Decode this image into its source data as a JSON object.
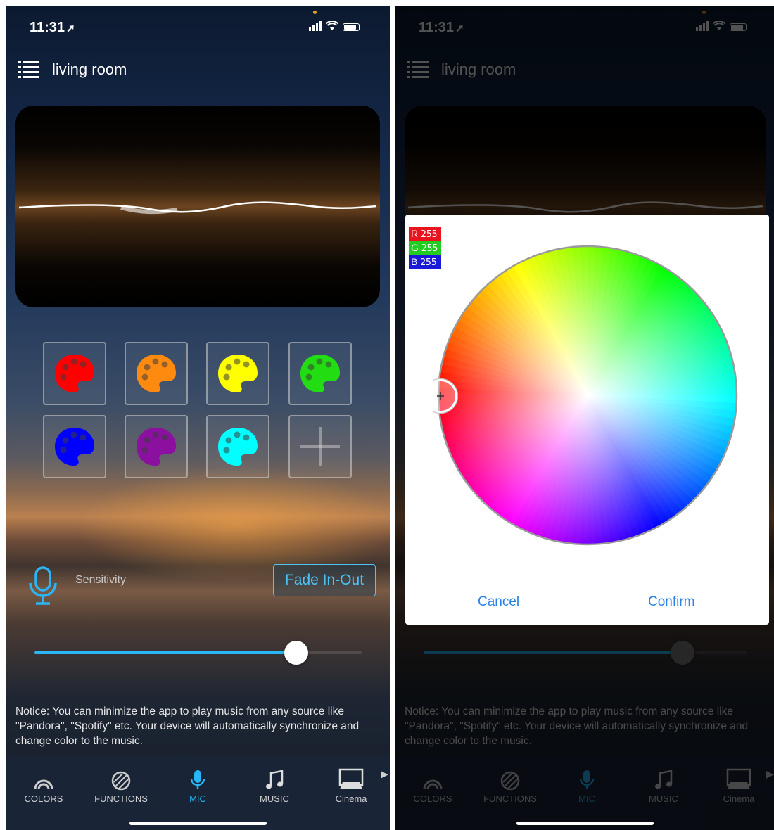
{
  "status_bar": {
    "time": "11:31"
  },
  "header": {
    "title": "living room"
  },
  "swatches": {
    "colors": [
      "#ff0000",
      "#ff8a10",
      "#ffff00",
      "#22dd11",
      "#0000ff",
      "#8b10a0",
      "#00ffff"
    ],
    "add_label": "+"
  },
  "mic_panel": {
    "sensitivity_label": "Sensitivity",
    "fade_button_label": "Fade In-Out",
    "sensitivity_value": 0.8
  },
  "notice": {
    "text": "Notice: You can minimize the app to play music from any source like \"Pandora\", \"Spotify\" etc. Your device will automatically synchronize and change color to the music."
  },
  "tabbar": {
    "tabs": [
      {
        "label": "COLORS",
        "icon": "rainbow-icon"
      },
      {
        "label": "FUNCTIONS",
        "icon": "striped-circle-icon"
      },
      {
        "label": "MIC",
        "icon": "microphone-icon",
        "active": true
      },
      {
        "label": "MUSIC",
        "icon": "music-note-icon"
      },
      {
        "label": "Cinema",
        "icon": "cinema-screen-icon"
      }
    ]
  },
  "color_dialog": {
    "r_label": "R",
    "r_value": "255",
    "g_label": "G",
    "g_value": "255",
    "b_label": "B",
    "b_value": "255",
    "r_color": "#e8141e",
    "g_color": "#22cc22",
    "b_color": "#1a1ad8",
    "cancel_label": "Cancel",
    "confirm_label": "Confirm"
  },
  "accent_color": "#29b6f6"
}
